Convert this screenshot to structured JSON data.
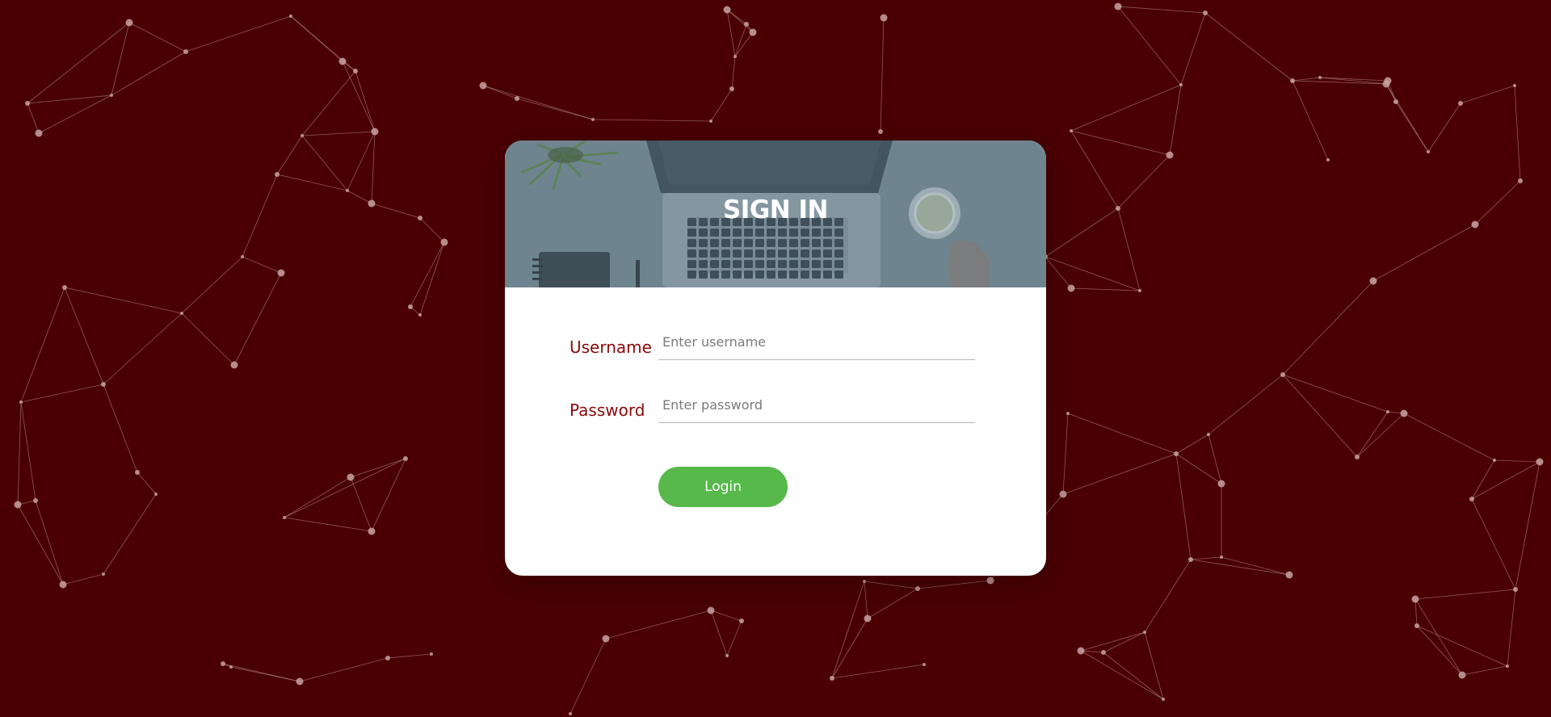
{
  "page": {
    "background_color": "#4a0003",
    "network_color": "#c9a2a2"
  },
  "card": {
    "title": "SIGN IN",
    "hero_image_icon": "laptop-desk-photo"
  },
  "form": {
    "username": {
      "label": "Username",
      "placeholder": "Enter username",
      "value": ""
    },
    "password": {
      "label": "Password",
      "placeholder": "Enter password",
      "value": ""
    },
    "login_label": "Login"
  },
  "colors": {
    "label": "#8a0a0a",
    "button": "#56b94a",
    "card": "#ffffff"
  }
}
